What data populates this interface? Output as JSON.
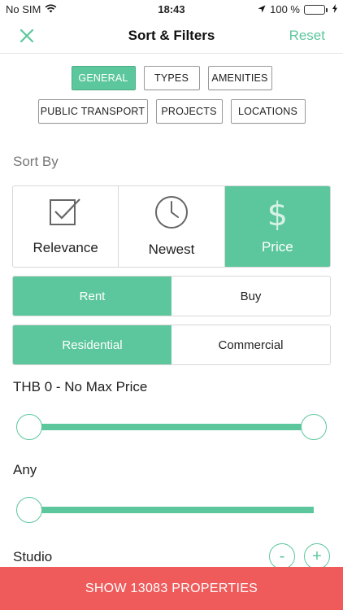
{
  "status_bar": {
    "carrier": "No SIM",
    "time": "18:43",
    "battery_percent": "100 %"
  },
  "nav": {
    "title": "Sort & Filters",
    "reset_label": "Reset"
  },
  "tabs_row1": [
    "GENERAL",
    "TYPES",
    "AMENITIES"
  ],
  "tabs_row2": [
    "PUBLIC TRANSPORT",
    "PROJECTS",
    "LOCATIONS"
  ],
  "active_tab": "GENERAL",
  "sort_by": {
    "label": "Sort By",
    "options": [
      "Relevance",
      "Newest",
      "Price"
    ],
    "selected": "Price"
  },
  "listing_type": {
    "options": [
      "Rent",
      "Buy"
    ],
    "selected": "Rent"
  },
  "property_category": {
    "options": [
      "Residential",
      "Commercial"
    ],
    "selected": "Residential"
  },
  "price": {
    "label": "THB 0 - No Max Price",
    "min_fraction": 0.0,
    "max_fraction": 1.0
  },
  "size": {
    "label": "Any",
    "value_fraction": 0.0
  },
  "bedrooms": {
    "label": "Studio",
    "minus": "-",
    "plus": "+"
  },
  "cta": {
    "label": "SHOW 13083 PROPERTIES"
  },
  "colors": {
    "accent": "#5cc79c",
    "cta": "#ef5b5b"
  }
}
